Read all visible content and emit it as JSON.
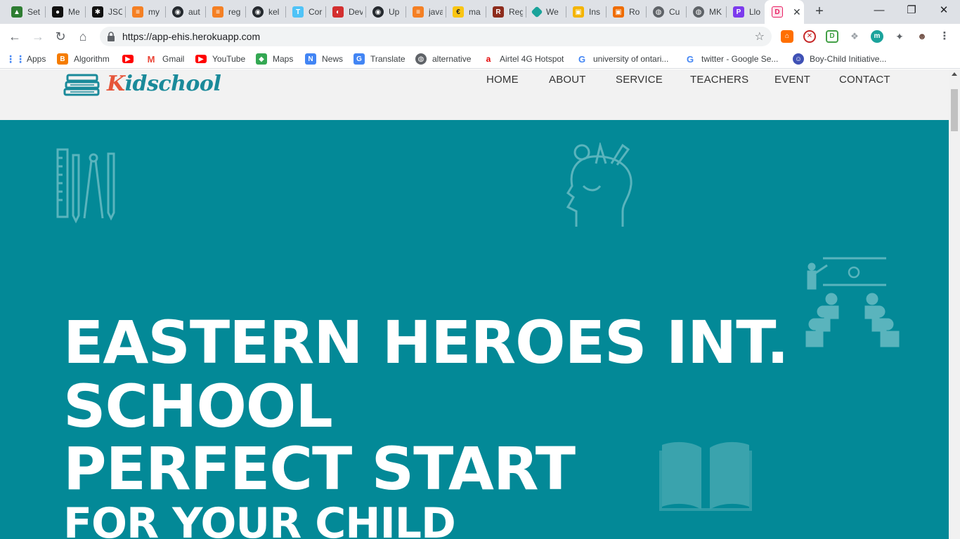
{
  "browser": {
    "tabs": [
      {
        "title": "Set",
        "color": "#2e7d32"
      },
      {
        "title": "Me",
        "color": "#111111"
      },
      {
        "title": "JSC",
        "color": "#111111"
      },
      {
        "title": "my",
        "color": "#f48024"
      },
      {
        "title": "aut",
        "color": "#24292e"
      },
      {
        "title": "reg",
        "color": "#f48024"
      },
      {
        "title": "kel",
        "color": "#24292e"
      },
      {
        "title": "Cor",
        "color": "#4fc3f7"
      },
      {
        "title": "Dev",
        "color": "#d32f2f"
      },
      {
        "title": "Up",
        "color": "#24292e"
      },
      {
        "title": "java",
        "color": "#f48024"
      },
      {
        "title": "ma",
        "color": "#f9c513"
      },
      {
        "title": "Reg",
        "color": "#8d2c1d"
      },
      {
        "title": "We",
        "color": "#1aa39a"
      },
      {
        "title": "Ins",
        "color": "#f4b400"
      },
      {
        "title": "Ro",
        "color": "#ef6c00"
      },
      {
        "title": "Cu",
        "color": "#5f6368"
      },
      {
        "title": "MK",
        "color": "#5f6368"
      },
      {
        "title": "Llo",
        "color": "#7c3aed"
      },
      {
        "title": "D",
        "color": "#e91e63"
      }
    ],
    "url": "https://app-ehis.herokuapp.com",
    "bookmarks": [
      {
        "label": "Apps",
        "icon": "apps-grid-icon",
        "color": "#4285f4"
      },
      {
        "label": "Algorithm",
        "icon": "blogger-icon",
        "color": "#f57c00"
      },
      {
        "label": "",
        "icon": "youtube-icon",
        "color": "#ff0000"
      },
      {
        "label": "Gmail",
        "icon": "gmail-icon",
        "color": "#ea4335"
      },
      {
        "label": "YouTube",
        "icon": "youtube-icon",
        "color": "#ff0000"
      },
      {
        "label": "Maps",
        "icon": "maps-icon",
        "color": "#34a853"
      },
      {
        "label": "News",
        "icon": "news-icon",
        "color": "#4285f4"
      },
      {
        "label": "Translate",
        "icon": "translate-icon",
        "color": "#4285f4"
      },
      {
        "label": "alternative",
        "icon": "globe-icon",
        "color": "#5f6368"
      },
      {
        "label": "Airtel 4G Hotspot",
        "icon": "airtel-icon",
        "color": "#e40000"
      },
      {
        "label": "university of ontari...",
        "icon": "google-icon",
        "color": "#4285f4"
      },
      {
        "label": "twitter - Google Se...",
        "icon": "google-icon",
        "color": "#4285f4"
      },
      {
        "label": "Boy-Child Initiative...",
        "icon": "boychild-icon",
        "color": "#3f51b5"
      }
    ]
  },
  "site": {
    "logo_text_first": "K",
    "logo_text_rest": "idschool",
    "nav": [
      "HOME",
      "ABOUT",
      "SERVICE",
      "TEACHERS",
      "EVENT",
      "CONTACT"
    ],
    "hero": {
      "line1": "EASTERN HEROES INT.",
      "line2": "SCHOOL",
      "line3": "PERFECT START",
      "line4": "FOR YOUR CHILD"
    },
    "hero_color": "#038997"
  }
}
